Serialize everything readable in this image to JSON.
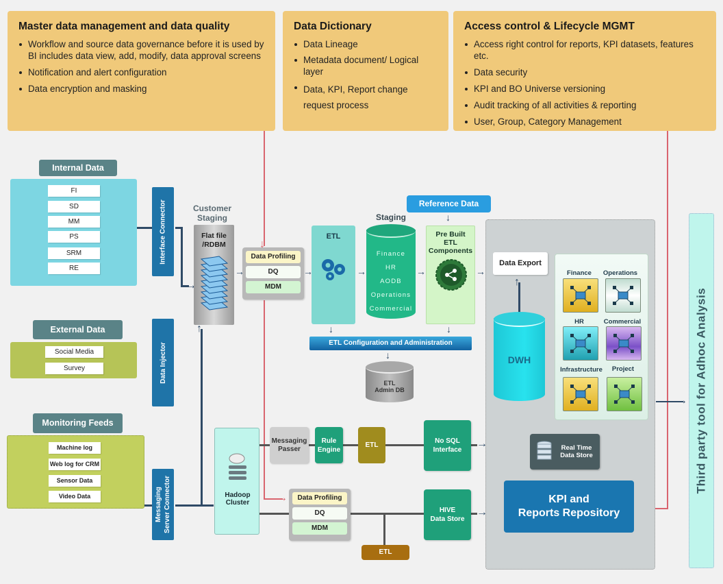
{
  "top_panels": {
    "mdm": {
      "title": "Master data management and data quality",
      "bullets": [
        "Workflow and source data governance before it is used by BI includes data view, add, modify, data approval screens",
        "Notification and alert configuration",
        "Data encryption and masking"
      ]
    },
    "dictionary": {
      "title": "Data Dictionary",
      "bullets": [
        "Data Lineage",
        "Metadata document/ Logical layer",
        "Data, KPI, Report change request process"
      ]
    },
    "access": {
      "title": "Access control & Lifecycle MGMT",
      "bullets": [
        "Access right control for reports, KPI datasets, features etc.",
        "Data security",
        "KPI and BO Universe versioning",
        "Audit tracking of all activities & reporting",
        "User, Group, Category Management"
      ]
    }
  },
  "sources": {
    "internal": {
      "title": "Internal Data",
      "items": [
        "FI",
        "SD",
        "MM",
        "PS",
        "SRM",
        "RE"
      ]
    },
    "external": {
      "title": "External Data",
      "items": [
        "Social Media",
        "Survey"
      ]
    },
    "monitoring": {
      "title": "Monitoring Feeds",
      "items": [
        "Machine log",
        "Web log for CRM",
        "Sensor Data",
        "Video Data"
      ]
    }
  },
  "connectors": {
    "interface": "Interface Connector",
    "injector": "Data Injector",
    "messaging_line1": "Messaging",
    "messaging_line2": "Server Connector"
  },
  "customer_staging": {
    "title_line1": "Customer",
    "title_line2": "Staging",
    "box_line1": "Flat file",
    "box_line2": "/RDBM"
  },
  "dq_block": {
    "profiling": "Data Profiling",
    "dq": "DQ",
    "mdm": "MDM"
  },
  "etl": {
    "title": "ETL"
  },
  "staging": {
    "title": "Staging",
    "items": [
      "Finance",
      "HR",
      "AODB",
      "Operations",
      "Commercial"
    ]
  },
  "reference_data": "Reference Data",
  "prebuilt": {
    "line1": "Pre Built",
    "line2": "ETL",
    "line3": "Components"
  },
  "etl_config": "ETL Configuration and Administration",
  "etl_admin_db": {
    "line1": "ETL",
    "line2": "Admin DB"
  },
  "warehouse": {
    "data_export": "Data Export",
    "dwh": "DWH",
    "marts": [
      "Finance",
      "Operations",
      "HR",
      "Commercial",
      "Infrastructure",
      "Project"
    ],
    "realtime_line1": "Real Time",
    "realtime_line2": "Data Store",
    "kpi_line1": "KPI and",
    "kpi_line2": "Reports Repository"
  },
  "hadoop": {
    "line1": "Hadoop",
    "line2": "Cluster"
  },
  "stream": {
    "messaging_line1": "Messaging",
    "messaging_line2": "Passer",
    "rule_line1": "Rule",
    "rule_line2": "Engine",
    "etl": "ETL",
    "nosql_line1": "No SQL",
    "nosql_line2": "Interface"
  },
  "batch": {
    "hive_line1": "HIVE",
    "hive_line2": "Data Store",
    "etl": "ETL"
  },
  "third_party": "Third party tool for Adhoc Analysis",
  "colors": {
    "panel": "#f0c97a",
    "header": "#5a8387",
    "connector": "#1f74a8",
    "green": "#1fa07a",
    "red_line": "#d9646e",
    "navy_line": "#2f4a66"
  }
}
